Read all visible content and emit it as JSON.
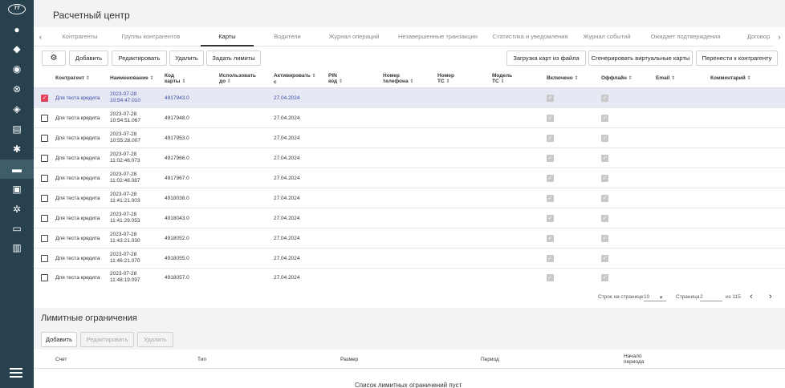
{
  "app": {
    "title": "Расчетный центр",
    "logo_text": "TT"
  },
  "rail_icons": [
    "user-icon",
    "diamond-icon",
    "tag-gear-icon",
    "dial-icon",
    "tag-icon",
    "receipt-icon",
    "network-icon",
    "cards-icon",
    "document-icon",
    "gears-icon",
    "card-icon",
    "report-icon"
  ],
  "tabs": [
    "Контрагенты",
    "Группы контрагентов",
    "Карты",
    "Водители",
    "Журнал операций",
    "Незавершенные транзакции",
    "Статистика и уведомления",
    "Журнал событий",
    "Ожидает подтверждения",
    "Договор"
  ],
  "active_tab": "Карты",
  "toolbar": {
    "settings_glyph": "⚙",
    "add": "Добавить",
    "edit": "Редактировать",
    "delete": "Удалить",
    "set_limits": "Задать лимиты",
    "upload": "Загрузка карт из файла",
    "generate": "Сгенерировать виртуальные карты",
    "transfer": "Перенести к контрагенту"
  },
  "table": {
    "headers": {
      "contragent": "Контрагент",
      "name": "Наименование",
      "card_code_1": "Код",
      "card_code_2": "карты",
      "use_until_1": "Использовать",
      "use_until_2": "до",
      "activate_1": "Активировать",
      "activate_2": "с",
      "pin_1": "PIN",
      "pin_2": "код",
      "phone_1": "Номер",
      "phone_2": "телефона",
      "ts_num_1": "Номер",
      "ts_num_2": "ТС",
      "ts_model_1": "Модель",
      "ts_model_2": "ТС",
      "enabled": "Включено",
      "offline": "Оффлайн",
      "email": "Email",
      "comment": "Комментарий"
    },
    "rows": [
      {
        "contragent": "Для теста кредита",
        "date": "2023-07-28",
        "time": "10:54:47.010",
        "code": "4917943.0",
        "activate": "27.04.2024",
        "selected": true
      },
      {
        "contragent": "Для теста кредита",
        "date": "2023-07-28",
        "time": "10:54:51.067",
        "code": "4917948.0",
        "activate": "27.04.2024",
        "selected": false
      },
      {
        "contragent": "Для теста кредита",
        "date": "2023-07-28",
        "time": "10:55:28.007",
        "code": "4917953.0",
        "activate": "27.04.2024",
        "selected": false
      },
      {
        "contragent": "Для теста кредита",
        "date": "2023-07-28",
        "time": "11:02:46.073",
        "code": "4917966.0",
        "activate": "27.04.2024",
        "selected": false
      },
      {
        "contragent": "Для теста кредита",
        "date": "2023-07-28",
        "time": "11:02:46.087",
        "code": "4917967.0",
        "activate": "27.04.2024",
        "selected": false
      },
      {
        "contragent": "Для теста кредита",
        "date": "2023-07-28",
        "time": "11:41:21.003",
        "code": "4918038.0",
        "activate": "27.04.2024",
        "selected": false
      },
      {
        "contragent": "Для теста кредита",
        "date": "2023-07-28",
        "time": "11:41:29.053",
        "code": "4918043.0",
        "activate": "27.04.2024",
        "selected": false
      },
      {
        "contragent": "Для теста кредита",
        "date": "2023-07-28",
        "time": "11:43:21.030",
        "code": "4918052.0",
        "activate": "27.04.2024",
        "selected": false
      },
      {
        "contragent": "Для теста кредита",
        "date": "2023-07-28",
        "time": "11:46:21.070",
        "code": "4918055.0",
        "activate": "27.04.2024",
        "selected": false
      },
      {
        "contragent": "Для теста кредита",
        "date": "2023-07-28",
        "time": "11:48:19.097",
        "code": "4918057.0",
        "activate": "27.04.2024",
        "selected": false
      }
    ]
  },
  "pagination": {
    "rows_per_page_label": "Строк на странице",
    "rows_per_page": "10",
    "page_label": "Страница",
    "page": "2",
    "of_total": "из 115"
  },
  "limits": {
    "title": "Лимитные ограничения",
    "add": "Добавить",
    "edit": "Редактировать",
    "delete": "Удалить",
    "headers": {
      "account": "Счет",
      "type": "Тип",
      "size": "Размер",
      "period": "Период",
      "period_start_1": "Начало",
      "period_start_2": "периода"
    },
    "empty": "Список лимитных ограничений пуст"
  },
  "colors": {
    "rail": "#27414f",
    "accent": "#e0435a",
    "link": "#3a4aa8",
    "selected_row": "#e6e9f3"
  }
}
